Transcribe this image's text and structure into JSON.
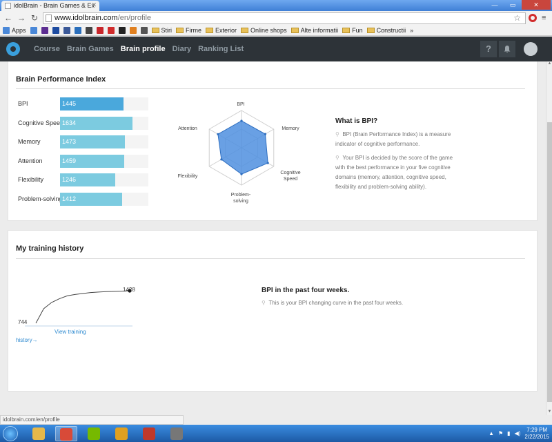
{
  "browser": {
    "tab_title": "idolBrain - Brain Games & Ex",
    "url_host": "www.idolbrain.com",
    "url_path": "/en/profile",
    "bookmarks": [
      {
        "label": "Apps",
        "color": "#4a88d8"
      },
      {
        "label": "",
        "color": "#4a88d8"
      },
      {
        "label": "",
        "color": "#5c2d91"
      },
      {
        "label": "",
        "color": "#1d4ba0"
      },
      {
        "label": "",
        "color": "#3b5998"
      },
      {
        "label": "",
        "color": "#2a6ebb"
      },
      {
        "label": "",
        "color": "#444444"
      },
      {
        "label": "",
        "color": "#c8262b"
      },
      {
        "label": "",
        "color": "#d12c2c"
      },
      {
        "label": "",
        "color": "#222222"
      },
      {
        "label": "",
        "color": "#e08020"
      },
      {
        "label": "",
        "color": "#555555"
      }
    ],
    "bookmark_folders": [
      "Stiri",
      "Firme",
      "Exterior",
      "Online shops",
      "Alte informatii",
      "Fun",
      "Constructii"
    ],
    "status_url": "idolbrain.com/en/profile"
  },
  "site": {
    "nav": [
      {
        "label": "Course",
        "active": false
      },
      {
        "label": "Brain Games",
        "active": false
      },
      {
        "label": "Brain profile",
        "active": true
      },
      {
        "label": "Diary",
        "active": false
      },
      {
        "label": "Ranking List",
        "active": false
      }
    ],
    "help_icon_glyph": "?"
  },
  "bpi_card": {
    "title": "Brain Performance Index",
    "scale_max": 2000,
    "rows": [
      {
        "label": "BPI",
        "value": 1445,
        "main": true
      },
      {
        "label": "Cognitive Speed",
        "value": 1634,
        "main": false
      },
      {
        "label": "Memory",
        "value": 1473,
        "main": false
      },
      {
        "label": "Attention",
        "value": 1459,
        "main": false
      },
      {
        "label": "Flexibility",
        "value": 1246,
        "main": false
      },
      {
        "label": "Problem-solving",
        "value": 1412,
        "main": false
      }
    ],
    "radar_labels": {
      "top": "BPI",
      "top_right": "Memory",
      "bottom_right": "Cognitive Speed",
      "bottom": "Problem-solving",
      "bottom_left": "Flexibility",
      "top_left": "Attention"
    },
    "info_title": "What is BPI?",
    "info_p1": "BPI (Brain Performance Index) is a measure indicator of cognitive performance.",
    "info_p2": "Your BPI is decided by the score of the game with the best performance in your five cognitive domains (memory, attention, cognitive speed, flexibility and problem-solving ability)."
  },
  "history_card": {
    "title": "My training history",
    "chart_data": {
      "type": "line",
      "series": [
        {
          "values": [
            744,
            1050,
            1180,
            1260,
            1320,
            1350,
            1370,
            1390,
            1400,
            1410,
            1415,
            1420,
            1428
          ]
        }
      ],
      "start_label": "744",
      "end_label": "1428"
    },
    "link_text_1": "View training",
    "link_text_2": "history→",
    "info_title": "BPI in the past four weeks",
    "info_title_suffix": ".",
    "info_p": "This is your BPI changing curve in the past four weeks."
  },
  "taskbar": {
    "time": "7:29 PM",
    "date": "2/22/2015",
    "apps": [
      {
        "name": "explorer",
        "color": "#e6b84a"
      },
      {
        "name": "chrome",
        "color": "#d84a38"
      },
      {
        "name": "nvidia",
        "color": "#76b900"
      },
      {
        "name": "app",
        "color": "#e0a020"
      },
      {
        "name": "app",
        "color": "#c0392b"
      },
      {
        "name": "m-app",
        "color": "#777777"
      }
    ]
  }
}
